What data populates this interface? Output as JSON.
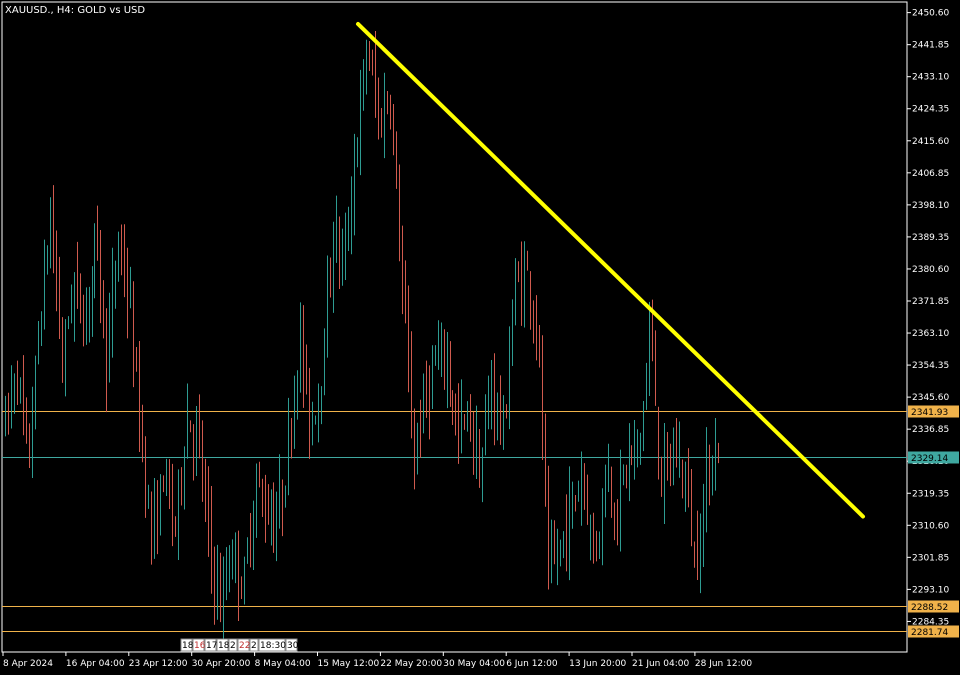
{
  "chart_data": {
    "type": "candlestick",
    "title": "XAUUSD., H4:  GOLD vs USD",
    "symbol": "XAUUSD.",
    "timeframe": "H4",
    "description": "GOLD vs USD",
    "ylim": [
      2276.0,
      2453.5
    ],
    "y_ticks": [
      "2450.60",
      "2441.85",
      "2433.10",
      "2424.35",
      "2415.60",
      "2406.85",
      "2398.10",
      "2389.35",
      "2380.60",
      "2371.85",
      "2363.10",
      "2354.35",
      "2345.60",
      "2336.85",
      "2328.10",
      "2319.35",
      "2310.60",
      "2301.85",
      "2293.10",
      "2284.35"
    ],
    "x_ticks": [
      "8 Apr 2024",
      "16 Apr 04:00",
      "23 Apr 12:00",
      "30 Apr 20:00",
      "8 May 04:00",
      "15 May 12:00",
      "22 May 20:00",
      "30 May 04:00",
      "6 Jun 12:00",
      "13 Jun 20:00",
      "21 Jun 04:00",
      "28 Jun 12:00"
    ],
    "price_levels": [
      {
        "value": 2341.93,
        "label": "2341.93",
        "color": "#f0b24a",
        "kind": "horizontal-line"
      },
      {
        "value": 2329.14,
        "label": "2329.14",
        "color": "#3fa8a0",
        "kind": "current-price"
      },
      {
        "value": 2288.52,
        "label": "2288.52",
        "color": "#f0b24a",
        "kind": "horizontal-line"
      },
      {
        "value": 2281.74,
        "label": "2281.74",
        "color": "#f0b24a",
        "kind": "horizontal-line"
      }
    ],
    "trendline": {
      "color": "#ffff00",
      "from": {
        "x": "15 May 12:00",
        "y": 2447.5
      },
      "to": {
        "x": "8 Jul 2024",
        "y": 2313.0
      }
    },
    "bull_color": "#2e9c92",
    "bear_color": "#d05a4e",
    "session_markers": [
      "18",
      "16",
      "17",
      "18",
      "2",
      "22",
      "2",
      "18:30",
      "30"
    ],
    "session_marker_highlights": [
      1,
      5
    ],
    "path_points": [
      {
        "t": "8 Apr 2024",
        "p": 2338
      },
      {
        "t": "10 Apr",
        "p": 2355
      },
      {
        "t": "11 Apr",
        "p": 2327
      },
      {
        "t": "12 Apr",
        "p": 2366
      },
      {
        "t": "12 Apr",
        "p": 2395
      },
      {
        "t": "15 Apr",
        "p": 2355
      },
      {
        "t": "16 Apr",
        "p": 2378
      },
      {
        "t": "17 Apr",
        "p": 2366
      },
      {
        "t": "17 Apr",
        "p": 2390
      },
      {
        "t": "18 Apr",
        "p": 2355
      },
      {
        "t": "19 Apr",
        "p": 2390
      },
      {
        "t": "19 Apr",
        "p": 2370
      },
      {
        "t": "22 Apr",
        "p": 2335
      },
      {
        "t": "23 Apr",
        "p": 2306
      },
      {
        "t": "24 Apr",
        "p": 2325
      },
      {
        "t": "25 Apr",
        "p": 2310
      },
      {
        "t": "26 Apr",
        "p": 2340
      },
      {
        "t": "29 Apr",
        "p": 2335
      },
      {
        "t": "30 Apr",
        "p": 2305
      },
      {
        "t": "1 May",
        "p": 2288
      },
      {
        "t": "2 May",
        "p": 2305
      },
      {
        "t": "3 May",
        "p": 2293
      },
      {
        "t": "6 May",
        "p": 2322
      },
      {
        "t": "7 May",
        "p": 2315
      },
      {
        "t": "8 May",
        "p": 2312
      },
      {
        "t": "9 May",
        "p": 2330
      },
      {
        "t": "10 May",
        "p": 2363
      },
      {
        "t": "13 May",
        "p": 2337
      },
      {
        "t": "14 May",
        "p": 2355
      },
      {
        "t": "15 May",
        "p": 2390
      },
      {
        "t": "16 May",
        "p": 2383
      },
      {
        "t": "17 May",
        "p": 2415
      },
      {
        "t": "20 May",
        "p": 2442
      },
      {
        "t": "20 May",
        "p": 2420
      },
      {
        "t": "21 May",
        "p": 2428
      },
      {
        "t": "22 May",
        "p": 2378
      },
      {
        "t": "23 May",
        "p": 2330
      },
      {
        "t": "24 May",
        "p": 2345
      },
      {
        "t": "27 May",
        "p": 2355
      },
      {
        "t": "28 May",
        "p": 2355
      },
      {
        "t": "29 May",
        "p": 2335
      },
      {
        "t": "30 May",
        "p": 2340
      },
      {
        "t": "30 May",
        "p": 2325
      },
      {
        "t": "31 May",
        "p": 2350
      },
      {
        "t": "3 Jun",
        "p": 2335
      },
      {
        "t": "4 Jun",
        "p": 2375
      },
      {
        "t": "5 Jun",
        "p": 2380
      },
      {
        "t": "6 Jun",
        "p": 2365
      },
      {
        "t": "7 Jun",
        "p": 2295
      },
      {
        "t": "10 Jun",
        "p": 2305
      },
      {
        "t": "11 Jun",
        "p": 2315
      },
      {
        "t": "12 Jun",
        "p": 2325
      },
      {
        "t": "13 Jun",
        "p": 2302
      },
      {
        "t": "14 Jun",
        "p": 2325
      },
      {
        "t": "17 Jun",
        "p": 2315
      },
      {
        "t": "18 Jun",
        "p": 2330
      },
      {
        "t": "19 Jun",
        "p": 2330
      },
      {
        "t": "20 Jun",
        "p": 2365
      },
      {
        "t": "21 Jun",
        "p": 2322
      },
      {
        "t": "24 Jun",
        "p": 2330
      },
      {
        "t": "25 Jun",
        "p": 2325
      },
      {
        "t": "26 Jun",
        "p": 2300
      },
      {
        "t": "27 Jun",
        "p": 2325
      },
      {
        "t": "28 Jun",
        "p": 2332
      }
    ]
  }
}
